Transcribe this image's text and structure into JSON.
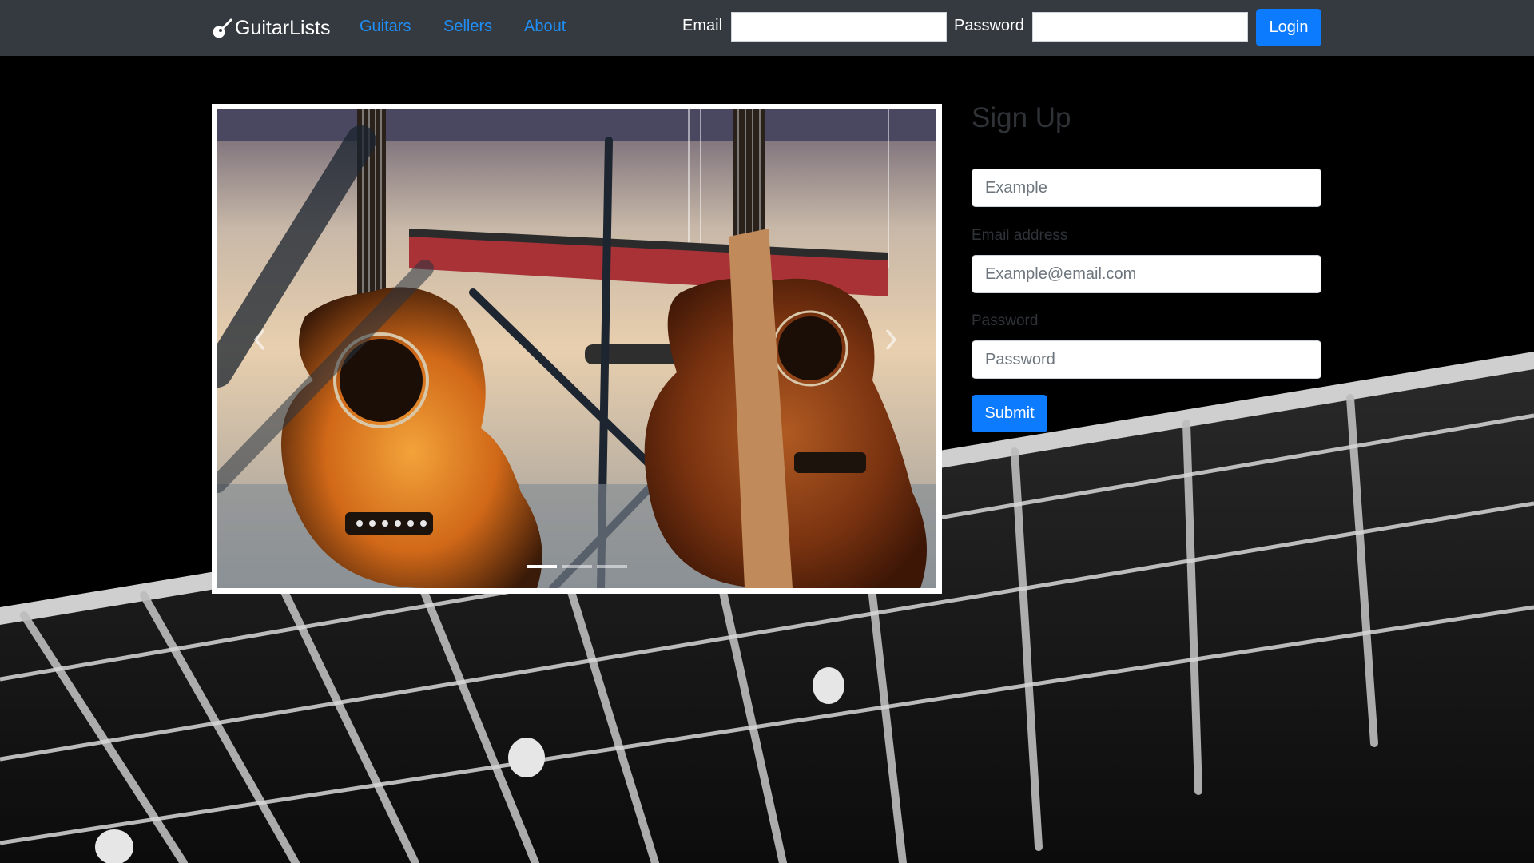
{
  "navbar": {
    "brand": "GuitarLists",
    "brand_icon": "guitar-icon",
    "links": [
      "Guitars",
      "Sellers",
      "About"
    ],
    "login": {
      "email_label": "Email",
      "password_label": "Password",
      "button_label": "Login"
    }
  },
  "carousel": {
    "image_description": "",
    "prev_icon": "chevron-left-icon",
    "next_icon": "chevron-right-icon",
    "active_slide": 1,
    "slide_count": 3
  },
  "signup": {
    "title": "Sign Up",
    "name_placeholder": "Example",
    "email_label": "Email address",
    "email_placeholder": "Example@email.com",
    "password_label": "Password",
    "password_placeholder": "Password",
    "submit_label": "Submit"
  },
  "colors": {
    "navbar_bg": "#343a40",
    "link": "#1f8ff7",
    "primary_button": "#0d7bfe",
    "page_bg": "#000000"
  }
}
